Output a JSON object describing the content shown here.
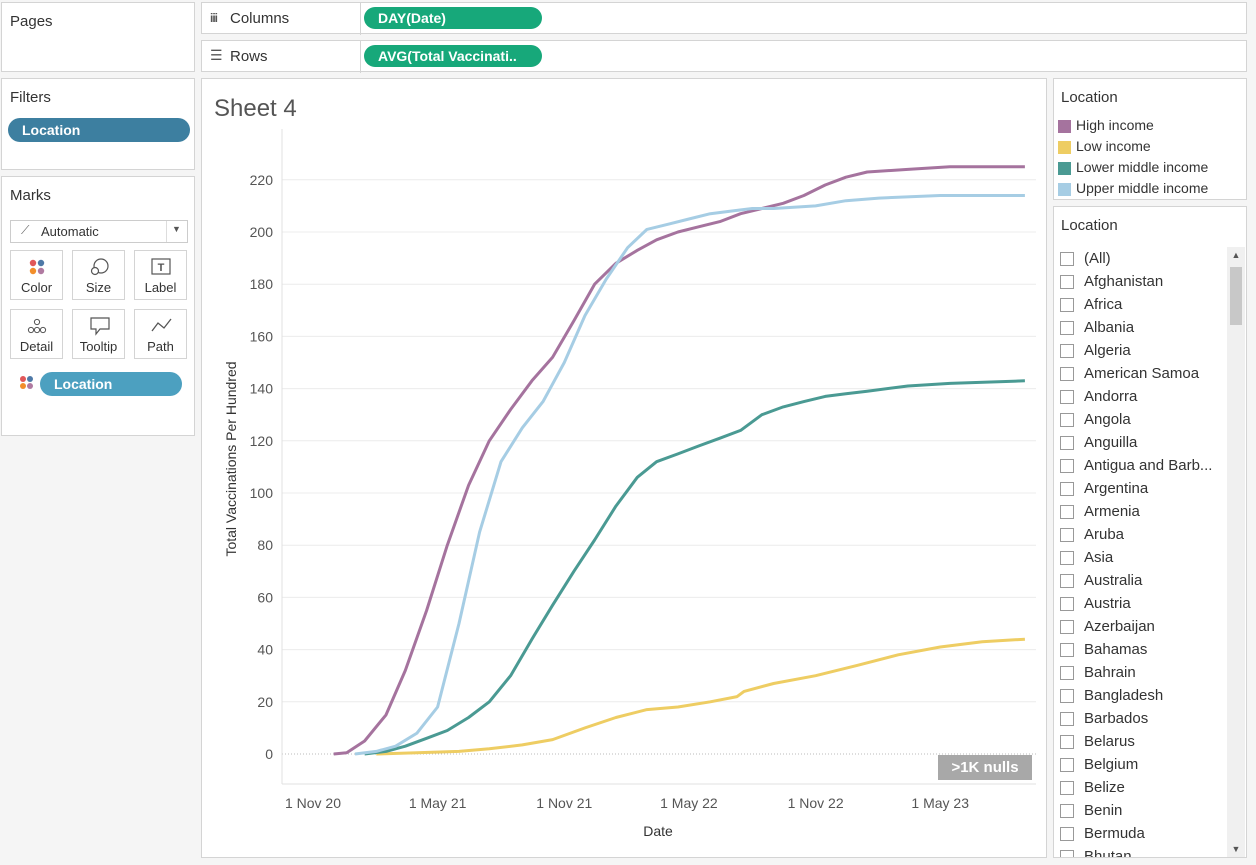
{
  "pages": {
    "title": "Pages"
  },
  "shelves": {
    "columns_label": "Columns",
    "columns_pill": "DAY(Date)",
    "rows_label": "Rows",
    "rows_pill": "AVG(Total Vaccinati.."
  },
  "filters": {
    "title": "Filters",
    "pill": "Location"
  },
  "marks": {
    "title": "Marks",
    "type": "Automatic",
    "buttons": [
      "Color",
      "Size",
      "Label",
      "Detail",
      "Tooltip",
      "Path"
    ],
    "pill": "Location"
  },
  "sheet": {
    "title": "Sheet 4",
    "nulls_badge": ">1K nulls"
  },
  "legend": {
    "title": "Location",
    "items": [
      {
        "label": "High income",
        "color": "#a5739e"
      },
      {
        "label": "Low income",
        "color": "#eecd63"
      },
      {
        "label": "Lower middle income",
        "color": "#4a9a93"
      },
      {
        "label": "Upper middle income",
        "color": "#a6cde4"
      }
    ]
  },
  "location_filter": {
    "title": "Location",
    "items": [
      "(All)",
      "Afghanistan",
      "Africa",
      "Albania",
      "Algeria",
      "American Samoa",
      "Andorra",
      "Angola",
      "Anguilla",
      "Antigua and Barb...",
      "Argentina",
      "Armenia",
      "Aruba",
      "Asia",
      "Australia",
      "Austria",
      "Azerbaijan",
      "Bahamas",
      "Bahrain",
      "Bangladesh",
      "Barbados",
      "Belarus",
      "Belgium",
      "Belize",
      "Benin",
      "Bermuda",
      "Bhutan"
    ]
  },
  "chart_data": {
    "type": "line",
    "xlabel": "Date",
    "ylabel": "Total Vaccinations Per Hundred",
    "x_ticks": [
      "1 Nov 20",
      "1 May 21",
      "1 Nov 21",
      "1 May 22",
      "1 Nov 22",
      "1 May 23"
    ],
    "y_ticks": [
      "0",
      "20",
      "40",
      "60",
      "80",
      "100",
      "120",
      "140",
      "160",
      "180",
      "200",
      "220"
    ],
    "ylim": [
      0,
      230
    ],
    "x_range": [
      "2020-11-01",
      "2023-10-01"
    ],
    "grid": true,
    "series": [
      {
        "name": "High income",
        "color": "#a5739e",
        "points": [
          [
            "2020-12-01",
            0
          ],
          [
            "2020-12-20",
            0.5
          ],
          [
            "2021-01-15",
            5
          ],
          [
            "2021-02-15",
            15
          ],
          [
            "2021-03-15",
            32
          ],
          [
            "2021-04-15",
            55
          ],
          [
            "2021-05-15",
            80
          ],
          [
            "2021-06-15",
            103
          ],
          [
            "2021-07-15",
            120
          ],
          [
            "2021-08-15",
            132
          ],
          [
            "2021-09-15",
            143
          ],
          [
            "2021-10-15",
            152
          ],
          [
            "2021-11-15",
            166
          ],
          [
            "2021-12-15",
            180
          ],
          [
            "2022-01-15",
            188
          ],
          [
            "2022-02-15",
            193
          ],
          [
            "2022-03-15",
            197
          ],
          [
            "2022-04-15",
            200
          ],
          [
            "2022-05-15",
            202
          ],
          [
            "2022-06-15",
            204
          ],
          [
            "2022-07-15",
            207
          ],
          [
            "2022-08-15",
            209
          ],
          [
            "2022-09-15",
            211
          ],
          [
            "2022-10-15",
            214
          ],
          [
            "2022-11-15",
            218
          ],
          [
            "2022-12-15",
            221
          ],
          [
            "2023-01-15",
            223
          ],
          [
            "2023-03-15",
            224
          ],
          [
            "2023-05-15",
            225
          ],
          [
            "2023-09-01",
            225
          ]
        ]
      },
      {
        "name": "Low income",
        "color": "#eecd63",
        "points": [
          [
            "2021-02-01",
            0
          ],
          [
            "2021-04-01",
            0.5
          ],
          [
            "2021-06-01",
            1
          ],
          [
            "2021-07-15",
            2
          ],
          [
            "2021-09-01",
            3.5
          ],
          [
            "2021-10-15",
            5.5
          ],
          [
            "2021-12-01",
            10
          ],
          [
            "2022-01-15",
            14
          ],
          [
            "2022-03-01",
            17
          ],
          [
            "2022-04-15",
            18
          ],
          [
            "2022-06-01",
            20
          ],
          [
            "2022-07-10",
            22
          ],
          [
            "2022-07-20",
            24
          ],
          [
            "2022-09-01",
            27
          ],
          [
            "2022-11-01",
            30
          ],
          [
            "2023-01-01",
            34
          ],
          [
            "2023-03-01",
            38
          ],
          [
            "2023-05-01",
            41
          ],
          [
            "2023-07-01",
            43
          ],
          [
            "2023-09-01",
            44
          ]
        ]
      },
      {
        "name": "Lower middle income",
        "color": "#4a9a93",
        "points": [
          [
            "2021-01-15",
            0
          ],
          [
            "2021-02-15",
            1
          ],
          [
            "2021-03-15",
            3
          ],
          [
            "2021-04-15",
            6
          ],
          [
            "2021-05-15",
            9
          ],
          [
            "2021-06-15",
            14
          ],
          [
            "2021-07-15",
            20
          ],
          [
            "2021-08-15",
            30
          ],
          [
            "2021-09-15",
            44
          ],
          [
            "2021-10-15",
            57
          ],
          [
            "2021-11-15",
            70
          ],
          [
            "2021-12-15",
            82
          ],
          [
            "2022-01-15",
            95
          ],
          [
            "2022-02-15",
            106
          ],
          [
            "2022-03-15",
            112
          ],
          [
            "2022-04-15",
            115
          ],
          [
            "2022-05-15",
            118
          ],
          [
            "2022-06-15",
            121
          ],
          [
            "2022-07-15",
            124
          ],
          [
            "2022-08-15",
            130
          ],
          [
            "2022-09-15",
            133
          ],
          [
            "2022-10-15",
            135
          ],
          [
            "2022-11-15",
            137
          ],
          [
            "2022-12-15",
            138
          ],
          [
            "2023-01-15",
            139
          ],
          [
            "2023-03-15",
            141
          ],
          [
            "2023-05-15",
            142
          ],
          [
            "2023-09-01",
            143
          ]
        ]
      },
      {
        "name": "Upper middle income",
        "color": "#a6cde4",
        "points": [
          [
            "2021-01-01",
            0
          ],
          [
            "2021-02-01",
            1
          ],
          [
            "2021-03-01",
            3
          ],
          [
            "2021-04-01",
            8
          ],
          [
            "2021-05-01",
            18
          ],
          [
            "2021-06-01",
            50
          ],
          [
            "2021-07-01",
            85
          ],
          [
            "2021-08-01",
            112
          ],
          [
            "2021-09-01",
            125
          ],
          [
            "2021-10-01",
            135
          ],
          [
            "2021-11-01",
            150
          ],
          [
            "2021-12-01",
            168
          ],
          [
            "2022-01-01",
            182
          ],
          [
            "2022-02-01",
            194
          ],
          [
            "2022-03-01",
            201
          ],
          [
            "2022-04-01",
            203
          ],
          [
            "2022-05-01",
            205
          ],
          [
            "2022-06-01",
            207
          ],
          [
            "2022-07-01",
            208
          ],
          [
            "2022-08-01",
            209
          ],
          [
            "2022-09-01",
            209
          ],
          [
            "2022-11-01",
            210
          ],
          [
            "2022-12-15",
            212
          ],
          [
            "2023-02-01",
            213
          ],
          [
            "2023-05-01",
            214
          ],
          [
            "2023-09-01",
            214
          ]
        ]
      }
    ]
  }
}
